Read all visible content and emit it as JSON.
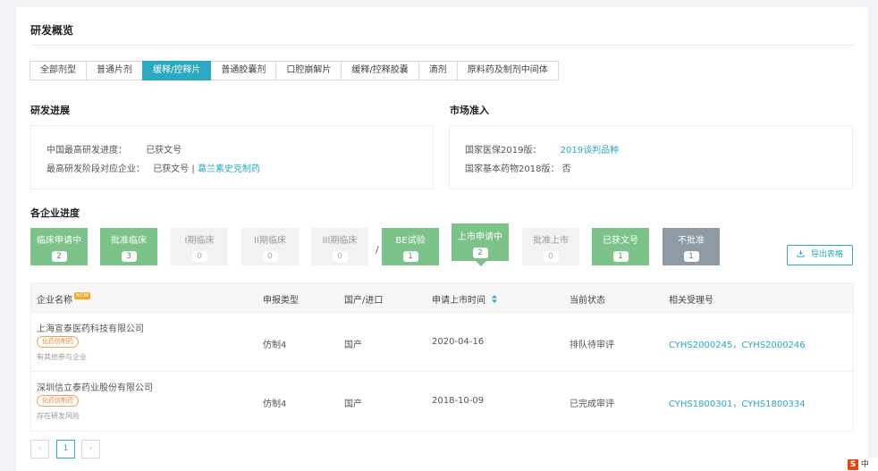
{
  "page": {
    "title": "研发概览"
  },
  "tabs": [
    "全部剂型",
    "普通片剂",
    "缓释/控释片",
    "普通胶囊剂",
    "口腔崩解片",
    "缓释/控释胶囊",
    "滴剂",
    "原料药及制剂中间体"
  ],
  "active_tab": "缓释/控释片",
  "rd_progress": {
    "title": "研发进展",
    "row1_label": "中国最高研发进度：",
    "row1_value": "已获文号",
    "row2_label": "最高研发阶段对应企业：",
    "row2_value": "已获文号 |",
    "row2_link": "葛兰素史克制药"
  },
  "market_access": {
    "title": "市场准入",
    "row1_label": "国家医保2019版：",
    "row1_link": "2019谈判品种",
    "row2_label": "国家基本药物2018版：",
    "row2_value": "否"
  },
  "company_progress": {
    "title": "各企业进度",
    "steps": [
      {
        "label": "临床申请中",
        "count": "2",
        "style": "green"
      },
      {
        "label": "批准临床",
        "count": "3",
        "style": "green"
      },
      {
        "label": "I期临床",
        "count": "0",
        "style": "grey"
      },
      {
        "label": "II期临床",
        "count": "0",
        "style": "grey"
      },
      {
        "label": "III期临床",
        "count": "0",
        "style": "grey"
      },
      {
        "label": "BE试验",
        "count": "1",
        "style": "green"
      },
      {
        "label": "上市申请中",
        "count": "2",
        "style": "green"
      },
      {
        "label": "批准上市",
        "count": "0",
        "style": "grey"
      },
      {
        "label": "已获文号",
        "count": "1",
        "style": "green"
      },
      {
        "label": "不批准",
        "count": "1",
        "style": "slate"
      }
    ],
    "separator": "/",
    "export_label": "导出表格"
  },
  "table": {
    "headers": [
      "企业名称",
      "申报类型",
      "国产/进口",
      "申请上市时间",
      "当前状态",
      "相关受理号"
    ],
    "new_badge": "NEW",
    "rows": [
      {
        "company": "上海宣泰医药科技有限公司",
        "tag": "化药仿制药",
        "note": "有其他参与企业",
        "type": "仿制4",
        "origin": "国产",
        "date": "2020-04-16",
        "status": "排队待审评",
        "accept_a": "CYHS2000245",
        "sep": "，",
        "accept_b": "CYHS2000246"
      },
      {
        "company": "深圳信立泰药业股份有限公司",
        "tag": "化药仿制药",
        "note": "存在研发风险",
        "type": "仿制4",
        "origin": "国产",
        "date": "2018-10-09",
        "status": "已完成审评",
        "accept_a": "CYHS1800301",
        "sep": "，",
        "accept_b": "CYHS1800334"
      }
    ]
  },
  "pagination": {
    "prev": "‹",
    "page": "1",
    "next": "›"
  },
  "ime": {
    "logo": "S",
    "text": "中"
  },
  "colors": {
    "accent": "#2aa9c0",
    "step_green": "#7cc38a",
    "step_grey": "#f2f2f2",
    "step_slate": "#8e9ba5",
    "tag_orange": "#e08a3c"
  }
}
